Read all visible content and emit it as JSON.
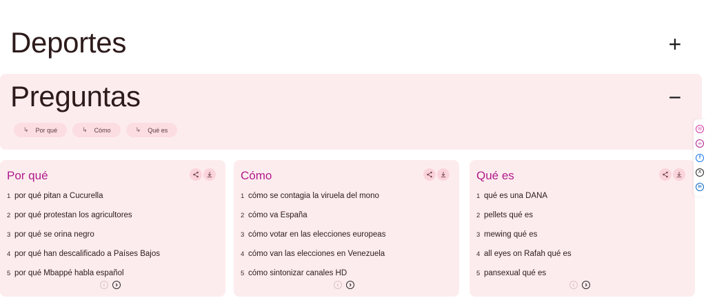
{
  "deportes": {
    "title": "Deportes",
    "toggle": "+"
  },
  "preguntas": {
    "title": "Preguntas",
    "toggle": "−",
    "chips": [
      {
        "arrow": "↳",
        "label": "Por qué"
      },
      {
        "arrow": "↳",
        "label": "Cómo"
      },
      {
        "arrow": "↳",
        "label": "Qué es"
      }
    ]
  },
  "cards": [
    {
      "title": "Por qué",
      "items": [
        {
          "num": "1",
          "text": "por qué pitan a Cucurella"
        },
        {
          "num": "2",
          "text": "por qué protestan los agricultores"
        },
        {
          "num": "3",
          "text": "por qué se orina negro"
        },
        {
          "num": "4",
          "text": "por qué han descalificado a Países Bajos"
        },
        {
          "num": "5",
          "text": "por qué Mbappé habla español"
        }
      ]
    },
    {
      "title": "Cómo",
      "items": [
        {
          "num": "1",
          "text": "cómo se contagia la viruela del mono"
        },
        {
          "num": "2",
          "text": "cómo va España"
        },
        {
          "num": "3",
          "text": "cómo votar en las elecciones europeas"
        },
        {
          "num": "4",
          "text": "cómo van las elecciones en Venezuela"
        },
        {
          "num": "5",
          "text": "cómo sintonizar canales HD"
        }
      ]
    },
    {
      "title": "Qué es",
      "items": [
        {
          "num": "1",
          "text": "qué es una DANA"
        },
        {
          "num": "2",
          "text": "pellets qué es"
        },
        {
          "num": "3",
          "text": "mewing qué es"
        },
        {
          "num": "4",
          "text": "all eyes on Rafah qué es"
        },
        {
          "num": "5",
          "text": "pansexual qué es"
        }
      ]
    }
  ],
  "icons": {
    "share": "share-icon",
    "download": "download-icon",
    "prev": "chevron-left-icon",
    "next": "chevron-right-icon"
  },
  "share_rail": [
    {
      "icon": "email-icon",
      "color": "#d0349e",
      "glyph": "✉"
    },
    {
      "icon": "link-icon",
      "color": "#b0198a",
      "glyph": "∞"
    },
    {
      "icon": "facebook-icon",
      "color": "#1877f2",
      "glyph": "f"
    },
    {
      "icon": "x-icon",
      "color": "#222222",
      "glyph": "X"
    },
    {
      "icon": "linkedin-icon",
      "color": "#0a66c2",
      "glyph": "in"
    }
  ],
  "colors": {
    "accent": "#b0198a",
    "panel_bg": "#fdecee",
    "chip_bg": "#fbdde2"
  }
}
